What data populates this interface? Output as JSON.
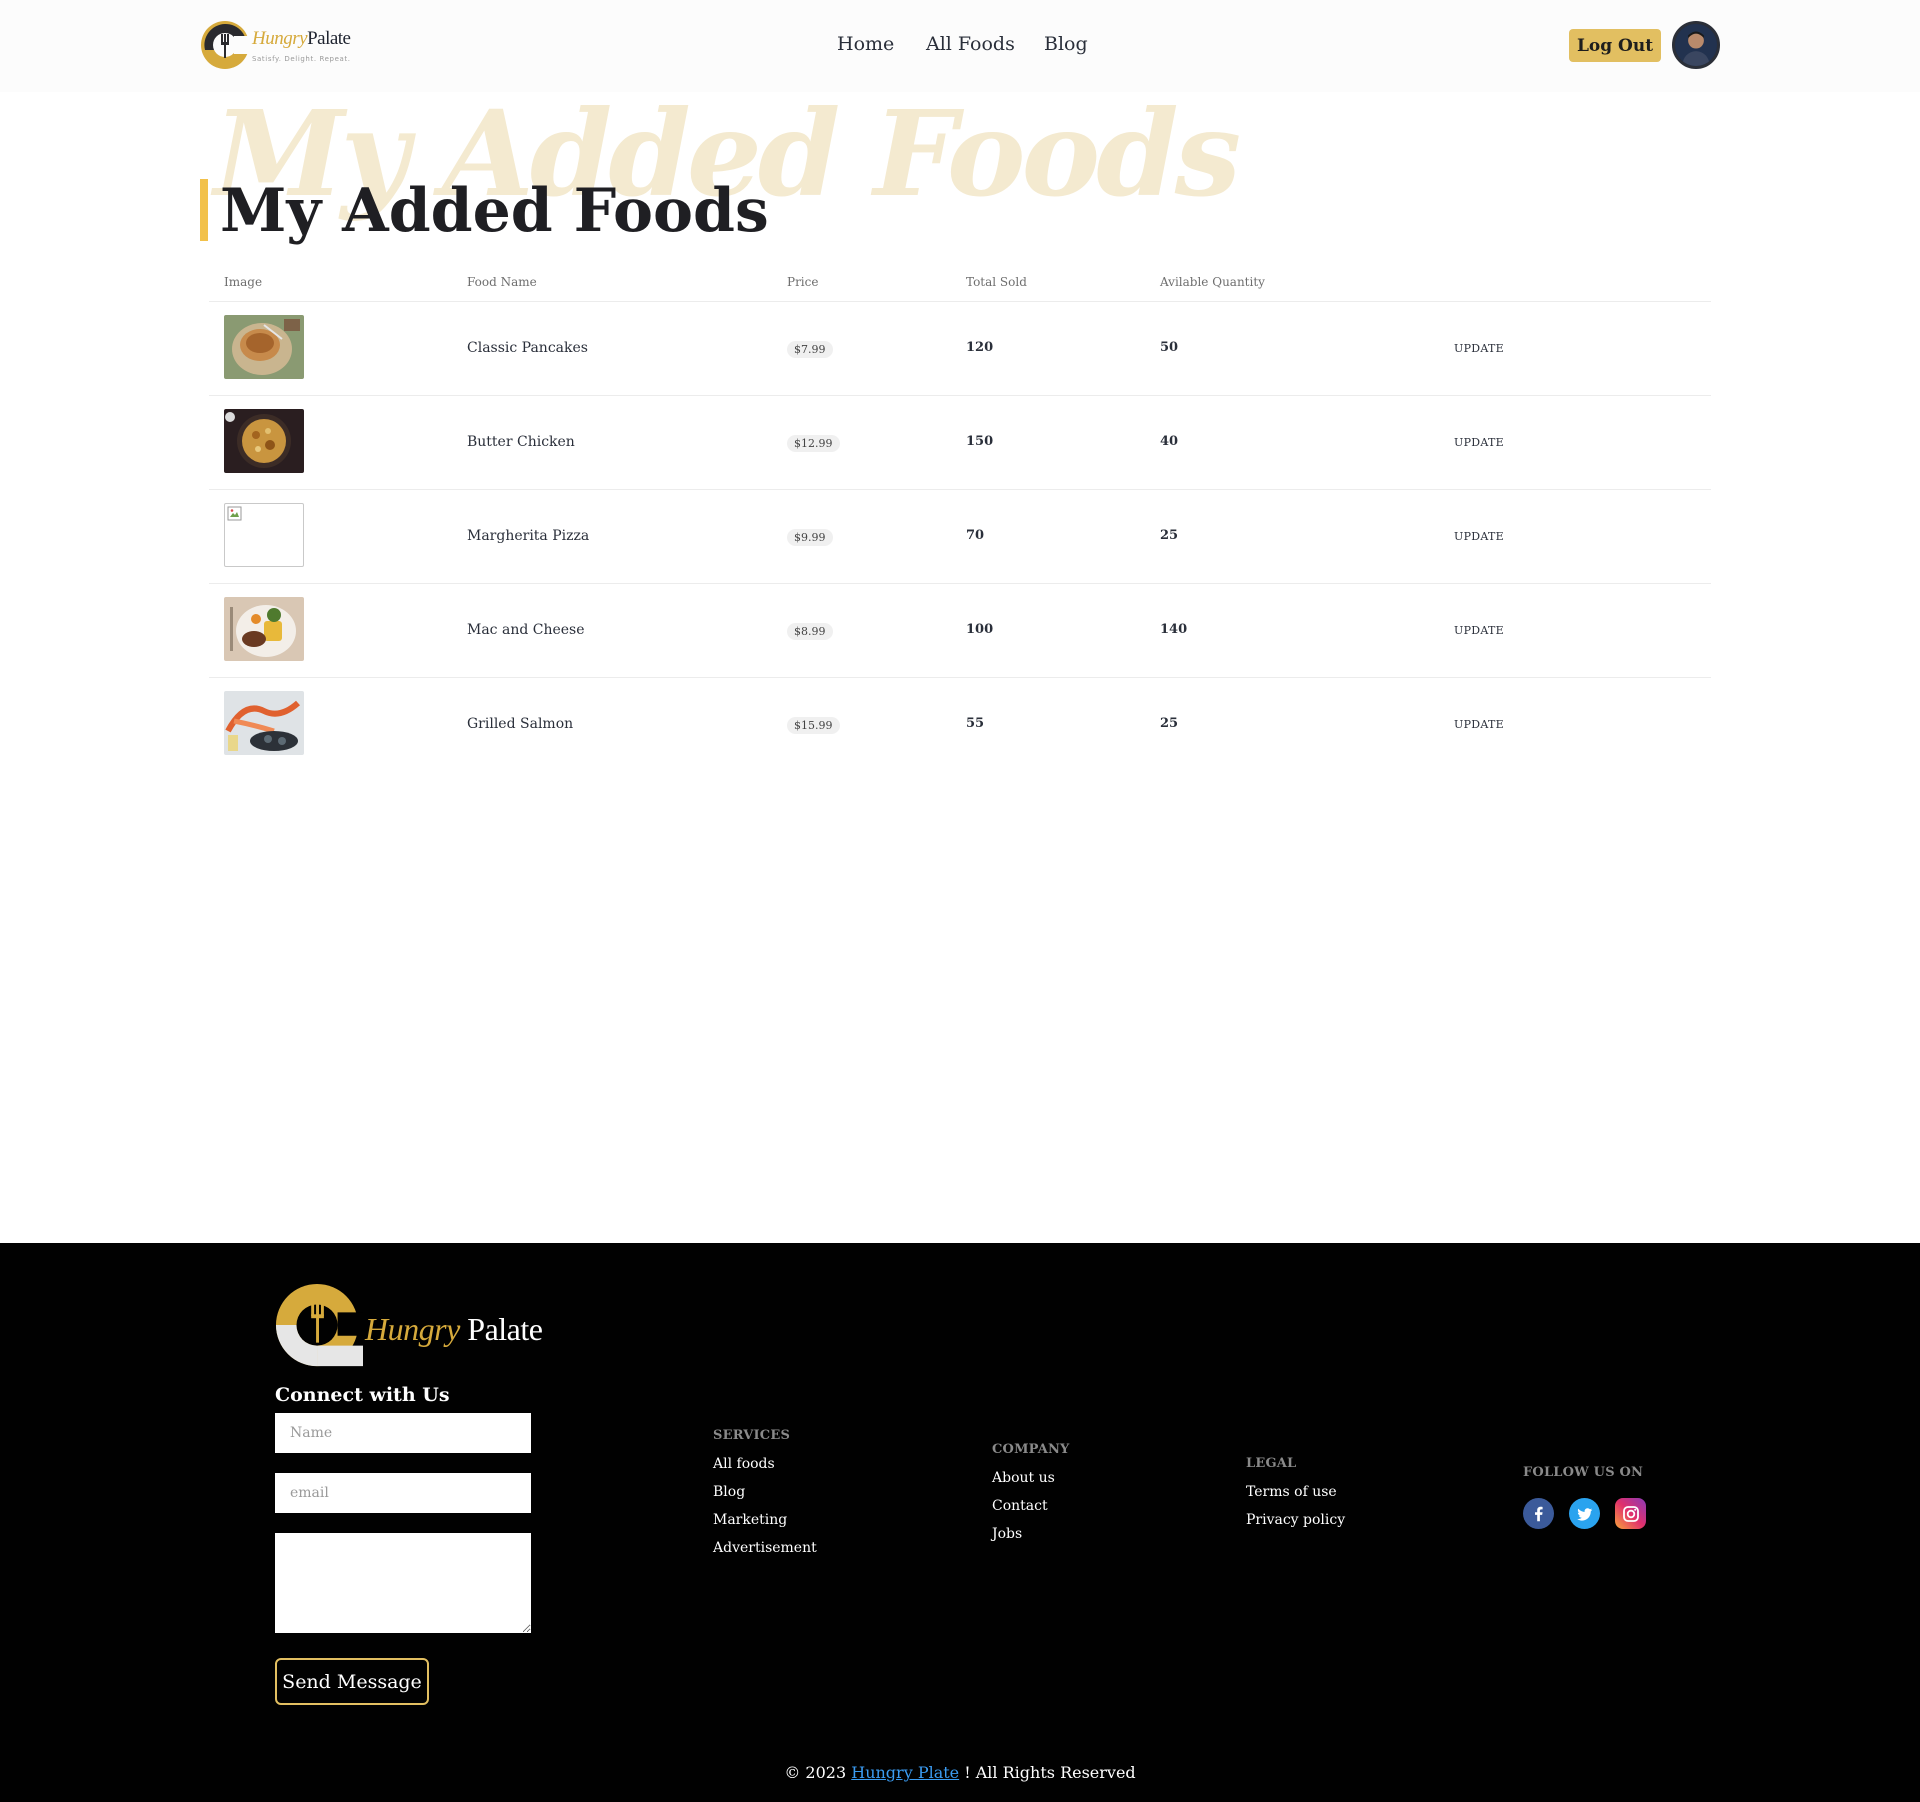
{
  "brand": {
    "name_part1": "Hungry",
    "name_part2": "Palate",
    "tagline": "Satisfy. Delight. Repeat."
  },
  "nav": {
    "home": "Home",
    "all_foods": "All Foods",
    "blog": "Blog"
  },
  "user": {
    "logout_label": "Log Out"
  },
  "page": {
    "title": "My Added Foods",
    "title_ghost": "My Added Foods"
  },
  "table": {
    "headers": [
      "Image",
      "Food Name",
      "Price",
      "Total Sold",
      "Avilable Quantity"
    ],
    "rows": [
      {
        "name": "Classic Pancakes",
        "price": "$7.99",
        "sold": "120",
        "qty": "50",
        "action": "UPDATE",
        "image": "pancakes"
      },
      {
        "name": "Butter Chicken",
        "price": "$12.99",
        "sold": "150",
        "qty": "40",
        "action": "UPDATE",
        "image": "butter-chicken"
      },
      {
        "name": "Margherita Pizza",
        "price": "$9.99",
        "sold": "70",
        "qty": "25",
        "action": "UPDATE",
        "image": "broken"
      },
      {
        "name": "Mac and Cheese",
        "price": "$8.99",
        "sold": "100",
        "qty": "140",
        "action": "UPDATE",
        "image": "mac-cheese"
      },
      {
        "name": "Grilled Salmon",
        "price": "$15.99",
        "sold": "55",
        "qty": "25",
        "action": "UPDATE",
        "image": "salmon"
      }
    ]
  },
  "footer": {
    "brand_part1": "Hungry",
    "brand_part2": "Palate",
    "connect_title": "Connect with Us",
    "name_placeholder": "Name",
    "email_placeholder": "email",
    "send_label": "Send Message",
    "services": {
      "heading": "SERVICES",
      "links": [
        "All foods",
        "Blog",
        "Marketing",
        "Advertisement"
      ]
    },
    "company": {
      "heading": "COMPANY",
      "links": [
        "About us",
        "Contact",
        "Jobs"
      ]
    },
    "legal": {
      "heading": "LEGAL",
      "links": [
        "Terms of use",
        "Privacy policy"
      ]
    },
    "follow": {
      "heading": "FOLLOW US ON",
      "icons": [
        "facebook-icon",
        "twitter-icon",
        "instagram-icon"
      ]
    },
    "copyright_prefix": "© 2023",
    "copyright_link": "Hungry Plate",
    "copyright_suffix": "! All Rights Reserved"
  },
  "colors": {
    "accent": "#e2bf61",
    "brand_gold": "#d6aa3c",
    "ghost_title": "#f4ead0",
    "footer_bg": "#010101",
    "link_blue": "#3b9cf2"
  }
}
